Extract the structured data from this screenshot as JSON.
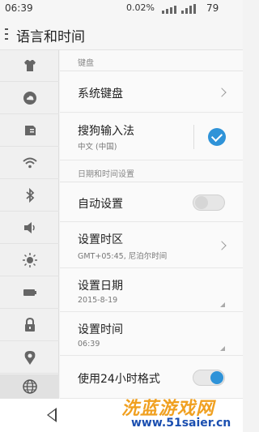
{
  "status_bar": {
    "time": "06:39",
    "network_speed": "0.02%",
    "battery": "79"
  },
  "header": {
    "title": "语言和时间"
  },
  "sidebar": {
    "items": [
      {
        "icon": "shirt-icon"
      },
      {
        "icon": "cloud-icon"
      },
      {
        "icon": "sim-card-icon"
      },
      {
        "icon": "wifi-icon"
      },
      {
        "icon": "bluetooth-icon"
      },
      {
        "icon": "speaker-icon"
      },
      {
        "icon": "brightness-icon"
      },
      {
        "icon": "battery-icon"
      },
      {
        "icon": "lock-icon"
      },
      {
        "icon": "location-icon"
      },
      {
        "icon": "globe-icon"
      }
    ],
    "active_index": 10
  },
  "sections": {
    "keyboard": {
      "header": "键盘",
      "system_keyboard": {
        "label": "系统键盘"
      },
      "sogou": {
        "label": "搜狗输入法",
        "sub": "中文 (中国)",
        "checked": true
      }
    },
    "datetime": {
      "header": "日期和时间设置",
      "auto_set": {
        "label": "自动设置",
        "on": false
      },
      "timezone": {
        "label": "设置时区",
        "sub": "GMT+05:45, 尼泊尔时间"
      },
      "date": {
        "label": "设置日期",
        "sub": "2015-8-19"
      },
      "time": {
        "label": "设置时间",
        "sub": "06:39"
      },
      "format24": {
        "label": "使用24小时格式",
        "on": true
      }
    }
  },
  "colors": {
    "accent": "#2f93d8",
    "watermark_orange": "#f0a020",
    "watermark_blue": "#1b4fb0"
  },
  "watermark": {
    "line1": "洗蓝游戏网",
    "line2": "www.51saier.cn"
  }
}
